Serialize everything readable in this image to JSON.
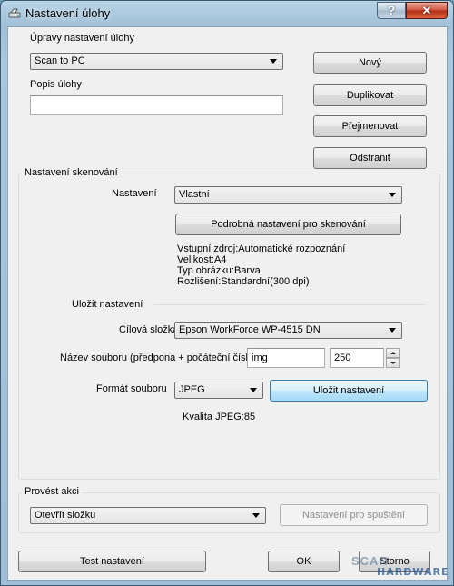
{
  "window": {
    "title": "Nastavení úlohy",
    "help_label": "?",
    "close_label": "✕"
  },
  "task": {
    "section_label": "Úpravy nastavení úlohy",
    "selected_task": "Scan to PC",
    "description_label": "Popis úlohy",
    "description_value": "",
    "buttons": {
      "new": "Nový",
      "duplicate": "Duplikovat",
      "rename": "Přejmenovat",
      "delete": "Odstranit"
    }
  },
  "scan": {
    "group_title": "Nastavení skenování",
    "settings_label": "Nastavení",
    "settings_value": "Vlastní",
    "detail_button": "Podrobná nastavení pro skenování",
    "info": [
      "Vstupní zdroj:Automatické rozpoznání",
      "Velikost:A4",
      "Typ obrázku:Barva",
      "Rozlišení:Standardní(300 dpi)"
    ],
    "save_section_label": "Uložit nastavení",
    "target_folder_label": "Cílová složka",
    "target_folder_value": "Epson WorkForce WP-4515 DN",
    "filename_label": "Název souboru (předpona + počáteční číslo)",
    "filename_prefix": "img",
    "filename_start": "250",
    "format_label": "Formát souboru",
    "format_value": "JPEG",
    "save_settings_button": "Uložit nastavení",
    "quality_text": "Kvalita JPEG:85"
  },
  "action": {
    "group_title": "Provést akci",
    "selected_action": "Otevřít složku",
    "launch_settings_button": "Nastavení pro spuštění"
  },
  "footer": {
    "test_button": "Test nastavení",
    "ok_button": "OK",
    "cancel_button": "Storno"
  },
  "watermark": {
    "line1": "SCAN",
    "line2": "HARDWARE"
  }
}
